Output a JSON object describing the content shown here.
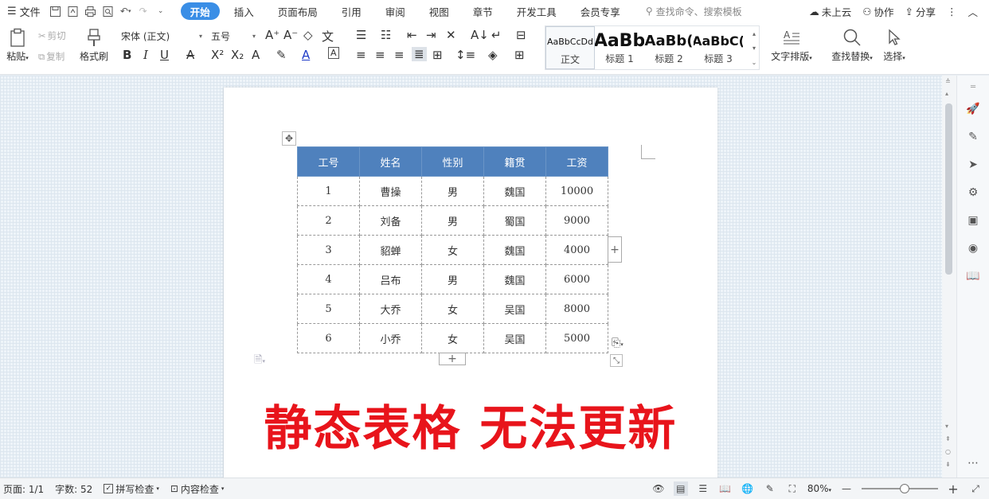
{
  "menubar": {
    "file_label": "文件",
    "tabs": [
      {
        "label": "开始",
        "active": true
      },
      {
        "label": "插入"
      },
      {
        "label": "页面布局"
      },
      {
        "label": "引用"
      },
      {
        "label": "审阅"
      },
      {
        "label": "视图"
      },
      {
        "label": "章节"
      },
      {
        "label": "开发工具"
      },
      {
        "label": "会员专享"
      }
    ],
    "search_placeholder": "查找命令、搜索模板",
    "cloud_label": "未上云",
    "collab_label": "协作",
    "share_label": "分享"
  },
  "ribbon": {
    "paste_label": "粘贴",
    "cut_label": "剪切",
    "copy_label": "复制",
    "format_painter_label": "格式刷",
    "font_name": "宋体 (正文)",
    "font_size": "五号",
    "styles": [
      {
        "sample": "AaBbCcDd",
        "label": "正文"
      },
      {
        "sample": "AaBb",
        "label": "标题 1"
      },
      {
        "sample": "AaBb(",
        "label": "标题 2"
      },
      {
        "sample": "AaBbC(",
        "label": "标题 3"
      }
    ],
    "text_layout_label": "文字排版",
    "find_replace_label": "查找替换",
    "select_label": "选择"
  },
  "table": {
    "headers": [
      "工号",
      "姓名",
      "性别",
      "籍贯",
      "工资"
    ],
    "rows": [
      [
        "1",
        "曹操",
        "男",
        "魏国",
        "10000"
      ],
      [
        "2",
        "刘备",
        "男",
        "蜀国",
        "9000"
      ],
      [
        "3",
        "貂蝉",
        "女",
        "魏国",
        "4000"
      ],
      [
        "4",
        "吕布",
        "男",
        "魏国",
        "6000"
      ],
      [
        "5",
        "大乔",
        "女",
        "吴国",
        "8000"
      ],
      [
        "6",
        "小乔",
        "女",
        "吴国",
        "5000"
      ]
    ]
  },
  "caption": "静态表格 无法更新",
  "statusbar": {
    "page": "页面: 1/1",
    "word_count": "字数: 52",
    "spell_check": "拼写检查",
    "content_check": "内容检查",
    "zoom": "80%"
  },
  "colors": {
    "accent": "#3a8ee6",
    "table_header": "#4f81bd",
    "caption_red": "#e8141b"
  }
}
